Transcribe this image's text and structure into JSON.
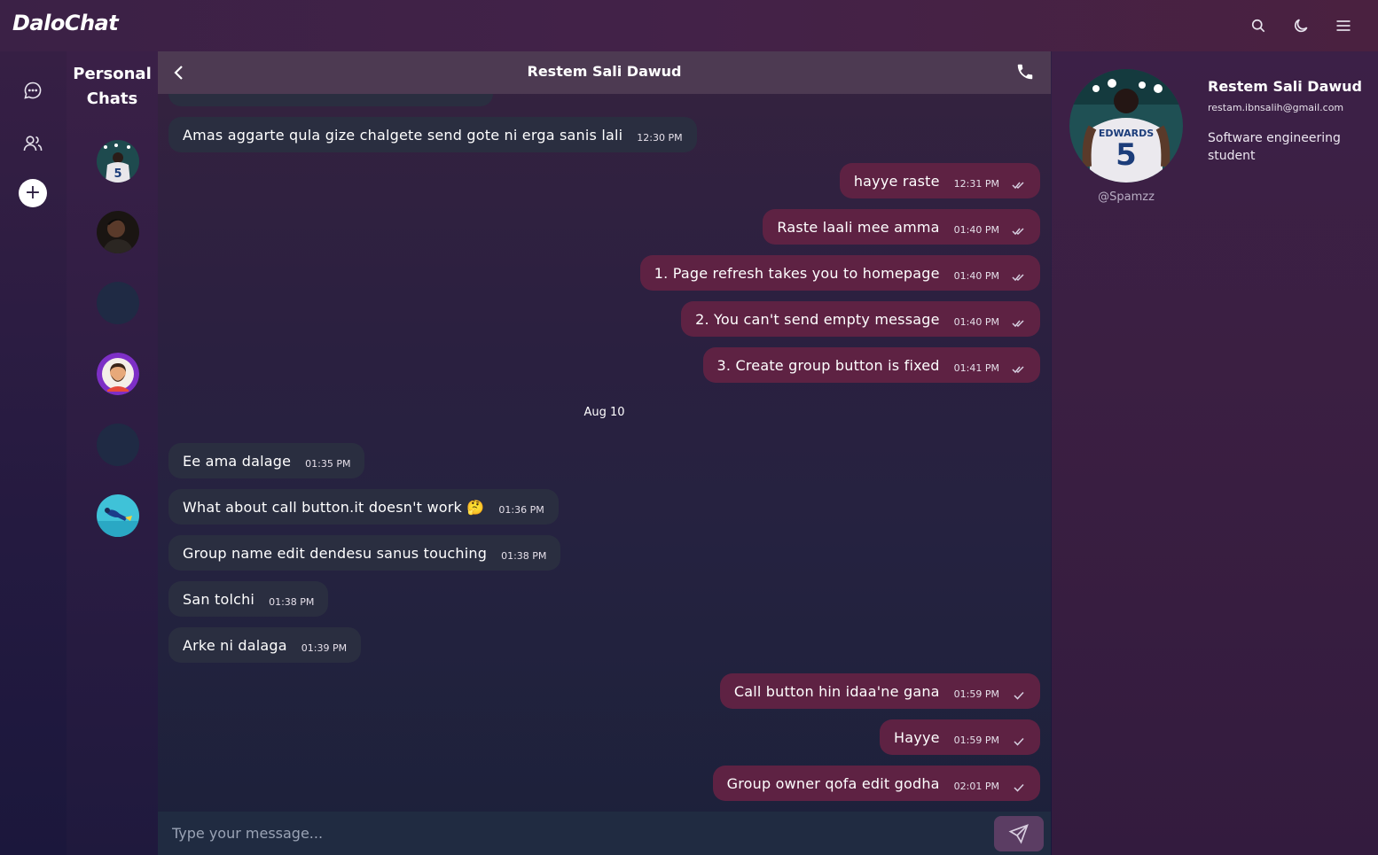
{
  "app": {
    "logo": "DaloChat"
  },
  "topbar": {
    "icons": [
      "search-icon",
      "moon-icon",
      "menu-icon"
    ]
  },
  "rail": {
    "icons": [
      "chat-bubble-icon",
      "users-icon"
    ],
    "add_label": "+"
  },
  "chatlist": {
    "title": "Personal Chats",
    "avatars": [
      "basketball-player",
      "man-dark-portrait",
      "empty",
      "bearded-man-purple-ring",
      "empty",
      "diver-teal"
    ]
  },
  "chat": {
    "title": "Restem Sali Dawud",
    "date_separator": "Aug 10",
    "messages": [
      {
        "dir": "in",
        "text": "Amas aggarte qula gize chalgete send gote ni erga sanis lali",
        "time": "12:30 PM"
      },
      {
        "dir": "out",
        "text": "hayye raste",
        "time": "12:31 PM",
        "status": "read"
      },
      {
        "dir": "out",
        "text": "Raste laali mee amma",
        "time": "01:40 PM",
        "status": "read"
      },
      {
        "dir": "out",
        "text": "1. Page refresh takes you to homepage",
        "time": "01:40 PM",
        "status": "read"
      },
      {
        "dir": "out",
        "text": "2. You can't send empty message",
        "time": "01:40 PM",
        "status": "read"
      },
      {
        "dir": "out",
        "text": "3. Create group button is fixed",
        "time": "01:41 PM",
        "status": "read"
      },
      {
        "dir": "in",
        "text": "Ee ama dalage",
        "time": "01:35 PM"
      },
      {
        "dir": "in",
        "text": "What about call button.it doesn't work 🤔",
        "time": "01:36 PM"
      },
      {
        "dir": "in",
        "text": "Group name edit dendesu sanus touching",
        "time": "01:38 PM"
      },
      {
        "dir": "in",
        "text": "San tolchi",
        "time": "01:38 PM"
      },
      {
        "dir": "in",
        "text": "Arke ni dalaga",
        "time": "01:39 PM"
      },
      {
        "dir": "out",
        "text": "Call button hin idaa'ne gana",
        "time": "01:59 PM",
        "status": "sent"
      },
      {
        "dir": "out",
        "text": "Hayye",
        "time": "01:59 PM",
        "status": "sent"
      },
      {
        "dir": "out",
        "text": "Group owner qofa edit godha",
        "time": "02:01 PM",
        "status": "sent"
      }
    ]
  },
  "composer": {
    "placeholder": "Type your message...",
    "value": ""
  },
  "profile": {
    "name": "Restem Sali Dawud",
    "email": "restam.ibnsalih@gmail.com",
    "bio": "Software engineering student",
    "handle": "@Spamzz",
    "jersey_name": "EDWARDS",
    "jersey_number": "5"
  },
  "colors": {
    "incoming_bubble": "#2a2e40",
    "outgoing_bubble": "#5e2243",
    "header": "#4d3a52",
    "composer": "#202b41"
  }
}
